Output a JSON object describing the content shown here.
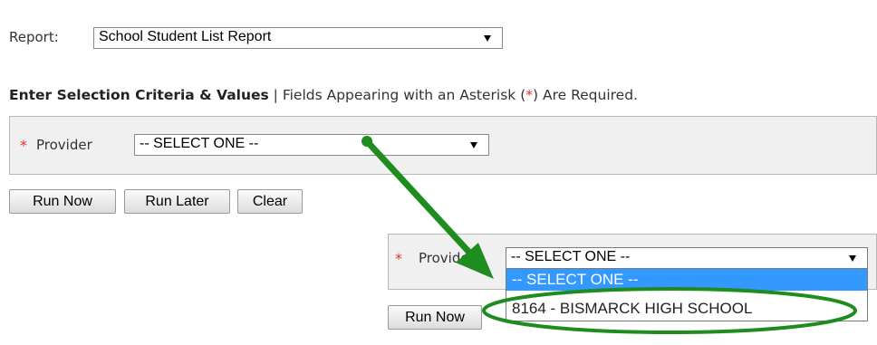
{
  "report": {
    "label": "Report:",
    "selected": "School Student List Report"
  },
  "criteria": {
    "heading": "Enter Selection Criteria & Values",
    "separator": " | ",
    "note_prefix": "Fields Appearing with an Asterisk (",
    "asterisk": "*",
    "note_suffix": ") Are Required."
  },
  "provider": {
    "asterisk": "*",
    "label": "Provider",
    "selected": "-- SELECT ONE --"
  },
  "buttons": {
    "run_now": "Run Now",
    "run_later": "Run Later",
    "clear": "Clear"
  },
  "zoom": {
    "asterisk": "*",
    "label": "Provider",
    "selected": "-- SELECT ONE --",
    "options": [
      "-- SELECT ONE --",
      "8164 - BISMARCK HIGH SCHOOL"
    ],
    "run_now": "Run Now"
  },
  "colors": {
    "required": "#e03131",
    "highlight": "#3399ff",
    "annotation": "#1e8c1e"
  },
  "icons": {
    "dropdown_arrow": "chevron-down-icon"
  }
}
